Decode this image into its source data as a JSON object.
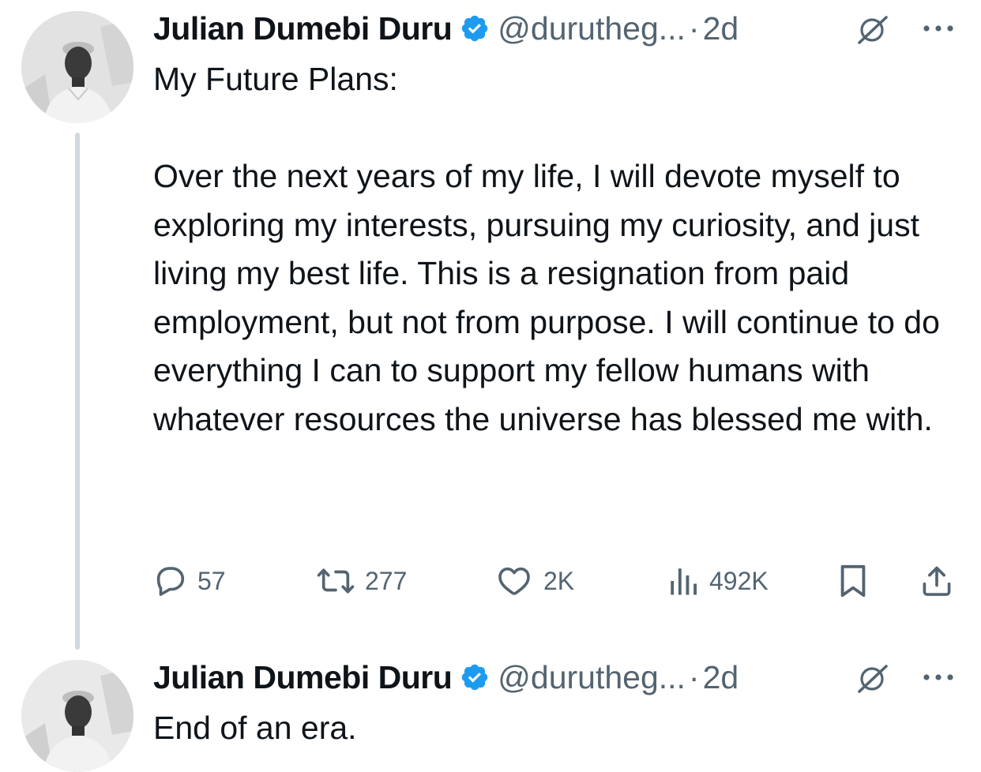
{
  "tweets": [
    {
      "author_name": "Julian Dumebi Duru",
      "handle": "@durutheg...",
      "separator": "·",
      "time": "2d",
      "text": "My Future Plans:\n\nOver the next years of my life, I will devote myself to exploring my interests, pursuing my curiosity, and just living my best life. This is a resignation from paid employment, but not from purpose. I will continue to do everything I can to support my fellow humans with whatever resources the universe has blessed me with.",
      "replies": "57",
      "reposts": "277",
      "likes": "2K",
      "views": "492K"
    },
    {
      "author_name": "Julian Dumebi Duru",
      "handle": "@durutheg...",
      "separator": "·",
      "time": "2d",
      "text": "End of an era."
    }
  ],
  "icons": {
    "verified": "verified-badge-icon",
    "grok": "grok-icon",
    "more": "more-icon",
    "reply": "reply-icon",
    "repost": "repost-icon",
    "like": "heart-icon",
    "views": "views-icon",
    "bookmark": "bookmark-icon",
    "share": "share-icon"
  },
  "colors": {
    "text": "#0f1419",
    "secondary": "#536471",
    "verified": "#1d9bf0",
    "thread_line": "#cfd9de"
  }
}
